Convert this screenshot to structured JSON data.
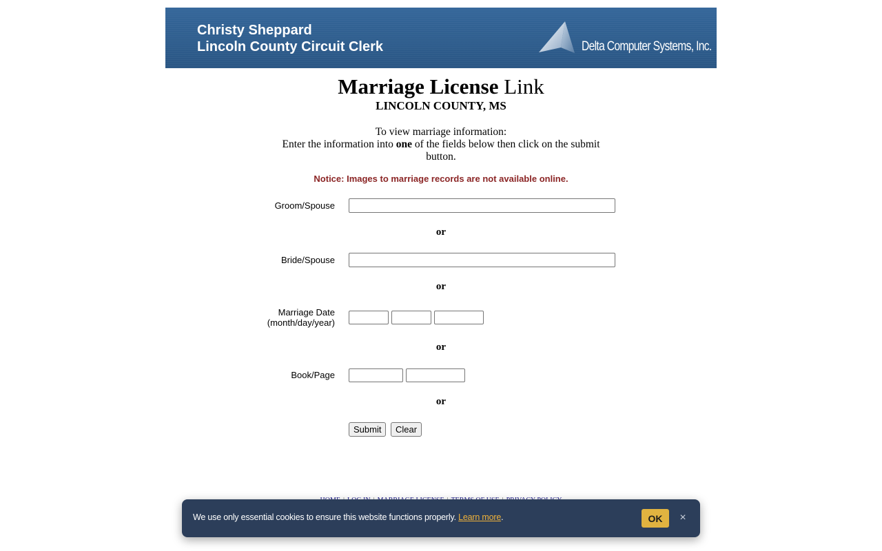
{
  "header": {
    "clerk_name": "Christy Sheppard",
    "clerk_title": "Lincoln County Circuit Clerk",
    "logo_text": "Delta Computer Systems, Inc."
  },
  "title": {
    "bold_part": "Marriage License",
    "plain_part": "Link",
    "county": "LINCOLN COUNTY, MS"
  },
  "instructions": {
    "line1": "To view marriage information:",
    "line2_pre": "Enter the information into",
    "line2_bold": "one",
    "line2_post": "of the fields below then click on the submit button."
  },
  "notice": "Notice: Images to marriage records are not available online.",
  "form": {
    "groom_label": "Groom/Spouse",
    "bride_label": "Bride/Spouse",
    "date_label_line1": "Marriage Date",
    "date_label_line2": "(month/day/year)",
    "book_label": "Book/Page",
    "or_text": "or",
    "groom_value": "",
    "bride_value": "",
    "month_value": "",
    "day_value": "",
    "year_value": "",
    "book_value": "",
    "page_value": "",
    "submit_label": "Submit",
    "clear_label": "Clear"
  },
  "footer_links": [
    "HOME",
    "LOG IN",
    "MARRIAGE LICENSE",
    "TERMS OF USE",
    "PRIVACY POLICY"
  ],
  "cookie": {
    "message": "We use only essential cookies to ensure this website functions properly.",
    "learn_more": "Learn more",
    "period": ".",
    "ok_label": "OK",
    "close_symbol": "×"
  },
  "colors": {
    "banner": "#2f5d89",
    "notice": "#8b2525",
    "cookie_bg": "#2c3e5a",
    "cookie_button": "#e1b340",
    "link": "#f0b23a"
  }
}
